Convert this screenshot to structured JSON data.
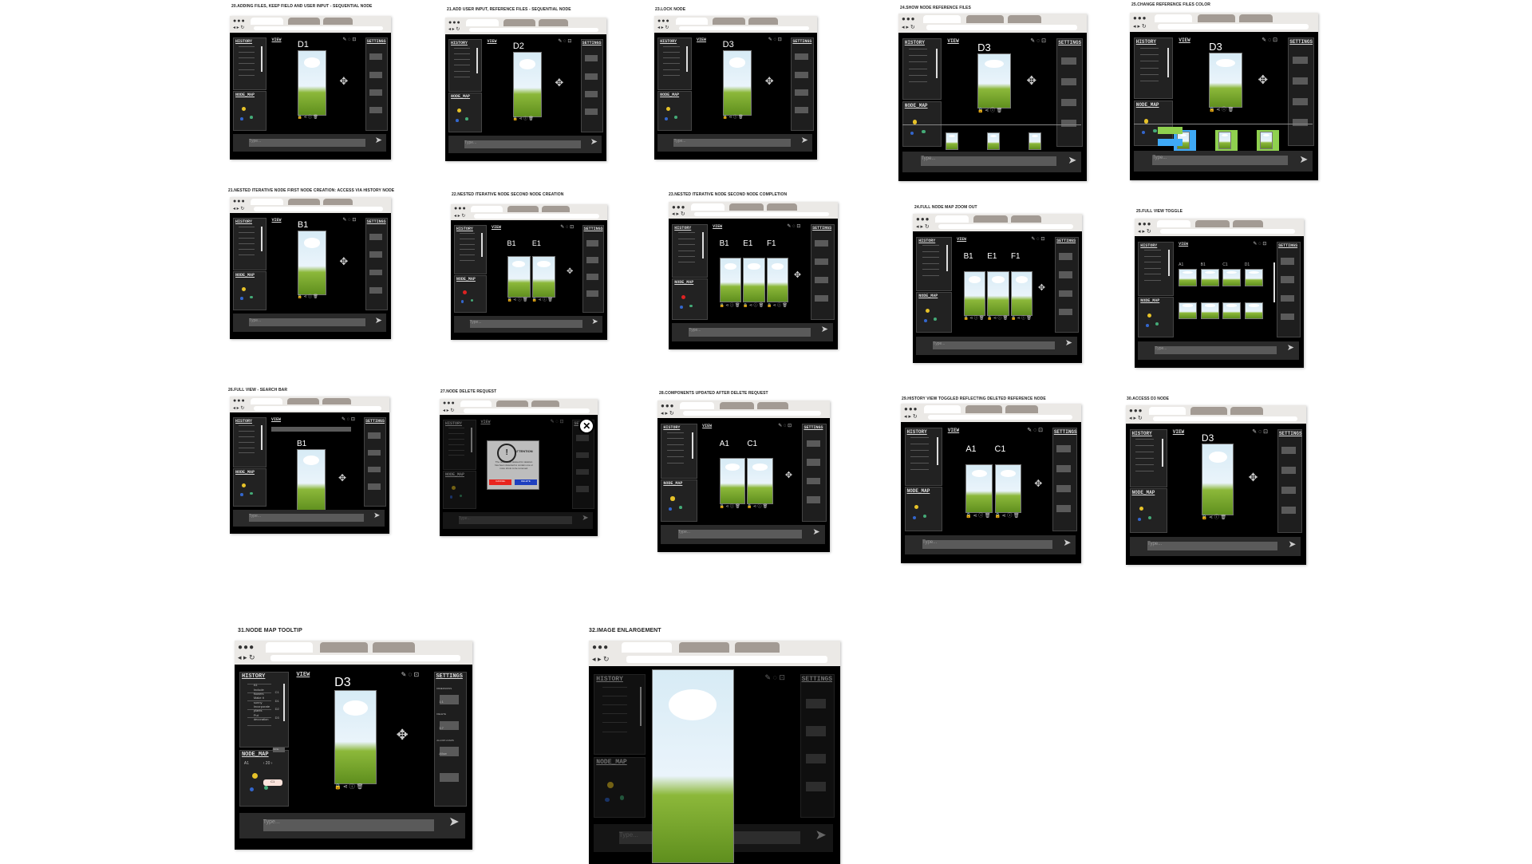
{
  "captions": {
    "f1": "20.ADDING FILES, KEEP FIELD AND USER INPUT - SEQUENTIAL NODE",
    "f2": "21.ADD USER INPUT, REFERENCE FILES - SEQUENTIAL NODE",
    "f3": "23.LOCK NODE",
    "f4": "24.SHOW NODE REFERENCE FILES",
    "f5": "25.CHANGE REFERENCE FILES COLOR",
    "f6": "21.NESTED ITERATIVE NODE FIRST NODE CREATION: ACCESS VIA HISTORY NODE",
    "f7": "22.NESTED ITERATIVE NODE SECOND NODE CREATION",
    "f8": "23.NESTED ITERATIVE NODE SECOND NODE COMPLETION",
    "f9": "24.FULL NODE MAP ZOOM OUT",
    "f10": "25.FULL VIEW TOGGLE",
    "f11": "26.FULL VIEW - SEARCH BAR",
    "f12": "27.NODE DELETE REQUEST",
    "f13": "28.COMPONENTS UPDATED AFTER DELETE REQUEST",
    "f14": "29.HISTORY VIEW TOGGLED REFLECTING DELETED REFERENCE NODE",
    "f15": "30.ACCESS D3 NODE",
    "f16": "31.NODE MAP TOOLTIP",
    "f17": "32.IMAGE ENLARGEMENT"
  },
  "labels": {
    "history": "HISTORY",
    "view": "VIEW",
    "settings": "SETTINGS",
    "node_map": "NODE_MAP",
    "type_placeholder": "Type...",
    "chat_placeholder": "Type something here...",
    "send_icon": "send-arrow-icon",
    "move_icon": "move-arrows-icon",
    "lock_icon": "lock-icon",
    "share_icon": "share-icon",
    "info_icon": "info-icon",
    "trash_icon": "trash-icon"
  },
  "frame_titles": {
    "f1": "D1",
    "f2": "D2",
    "f3": "D3",
    "f4": "D3",
    "f5": "D3",
    "f6": "B1",
    "f7a": "B1",
    "f7b": "E1",
    "f8a": "B1",
    "f8b": "E1",
    "f8c": "F1",
    "f9a": "B1",
    "f9b": "E1",
    "f9c": "F1",
    "f10a": "A1",
    "f10b": "B1",
    "f10c": "C1",
    "f10d": "D1",
    "f11": "B1",
    "f13a": "A1",
    "f13b": "C1",
    "f14a": "A1",
    "f14b": "C1",
    "f15": "D3",
    "f16": "D3"
  },
  "history_items_f16": [
    "A1",
    "Include",
    "flowers",
    "Make it",
    "sunny",
    "Incorporate",
    "plants",
    "Put",
    "decoration"
  ],
  "history_values_f16": [
    "C1",
    "D1",
    "D2",
    "D3"
  ],
  "node_map_f16": {
    "node": "A1",
    "zoom": "20",
    "toggle": "Circle",
    "tooltip": "C1"
  },
  "settings_f16": {
    "items": [
      "DIMENSIONS",
      "DELETE",
      "ALLOW LOADS"
    ],
    "values": [
      "1:1",
      "3:7",
      "Allow"
    ]
  },
  "dialog": {
    "title": "ATTENTION",
    "message": "The node to be deleted for deletion has been detected to contain one or more shots to be removed.",
    "cancel": "CANCEL",
    "delete": "DELETE"
  },
  "colors": {
    "frame_bg": "#000000",
    "chrome": "#ebe9e6",
    "tab": "#a39b94",
    "dialog_cancel": "#e8241f",
    "dialog_delete": "#1e3fbf",
    "ref_green": "#8fd14f",
    "ref_blue": "#3fa9f5"
  }
}
